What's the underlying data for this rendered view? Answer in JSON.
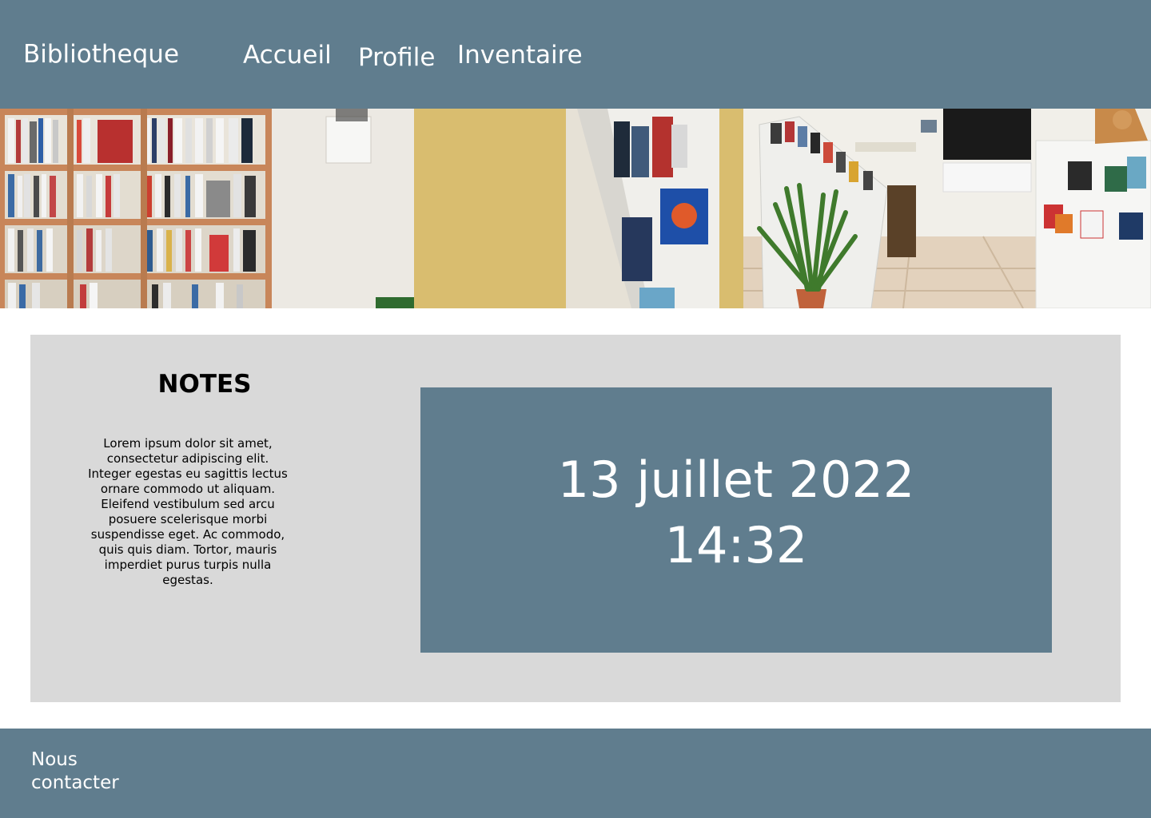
{
  "header": {
    "brand": "Bibliotheque",
    "nav": [
      {
        "label": "Accueil"
      },
      {
        "label": "Profile"
      },
      {
        "label": "Inventaire"
      }
    ]
  },
  "notes": {
    "title": "NOTES",
    "body": "Lorem ipsum dolor sit amet, consectetur adipiscing elit. Integer egestas eu sagittis lectus ornare commodo ut aliquam. Eleifend vestibulum sed arcu posuere scelerisque morbi suspendisse eget. Ac commodo, quis quis diam. Tortor, mauris imperdiet purus turpis nulla egestas."
  },
  "clock": {
    "date": "13 juillet 2022",
    "time": "14:32"
  },
  "footer": {
    "contact": "Nous contacter"
  },
  "colors": {
    "primary": "#607d8e",
    "panel": "#d9d9d9",
    "text_light": "#ffffff"
  }
}
